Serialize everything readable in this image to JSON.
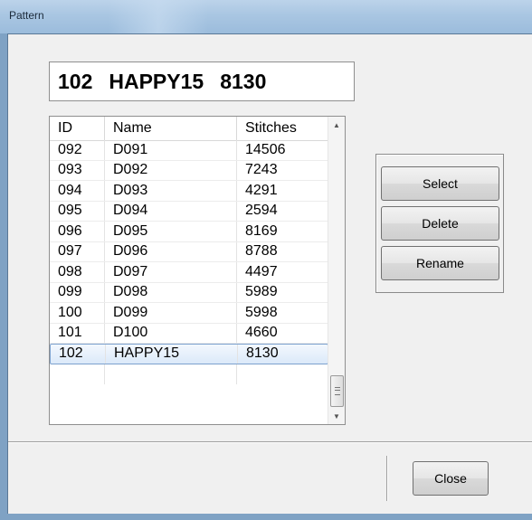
{
  "window": {
    "title": "Pattern"
  },
  "selected_display": {
    "id": "102",
    "name": "HAPPY15",
    "stitches": "8130"
  },
  "list": {
    "headers": {
      "id": "ID",
      "name": "Name",
      "stitches": "Stitches"
    },
    "rows": [
      {
        "id": "092",
        "name": "D091",
        "stitches": "14506"
      },
      {
        "id": "093",
        "name": "D092",
        "stitches": "7243"
      },
      {
        "id": "094",
        "name": "D093",
        "stitches": "4291"
      },
      {
        "id": "095",
        "name": "D094",
        "stitches": "2594"
      },
      {
        "id": "096",
        "name": "D095",
        "stitches": "8169"
      },
      {
        "id": "097",
        "name": "D096",
        "stitches": "8788"
      },
      {
        "id": "098",
        "name": "D097",
        "stitches": "4497"
      },
      {
        "id": "099",
        "name": "D098",
        "stitches": "5989"
      },
      {
        "id": "100",
        "name": "D099",
        "stitches": "5998"
      },
      {
        "id": "101",
        "name": "D100",
        "stitches": "4660"
      },
      {
        "id": "102",
        "name": "HAPPY15",
        "stitches": "8130"
      }
    ],
    "selected_row_index": 10
  },
  "buttons": {
    "select": "Select",
    "delete": "Delete",
    "rename": "Rename",
    "close": "Close"
  },
  "icons": {
    "scroll_up": "up-arrow-icon",
    "scroll_down": "down-arrow-icon",
    "thumb_grip": "grip-icon"
  },
  "colors": {
    "selection_border": "#7da2ce",
    "title_bar": "#a9c6e2"
  }
}
